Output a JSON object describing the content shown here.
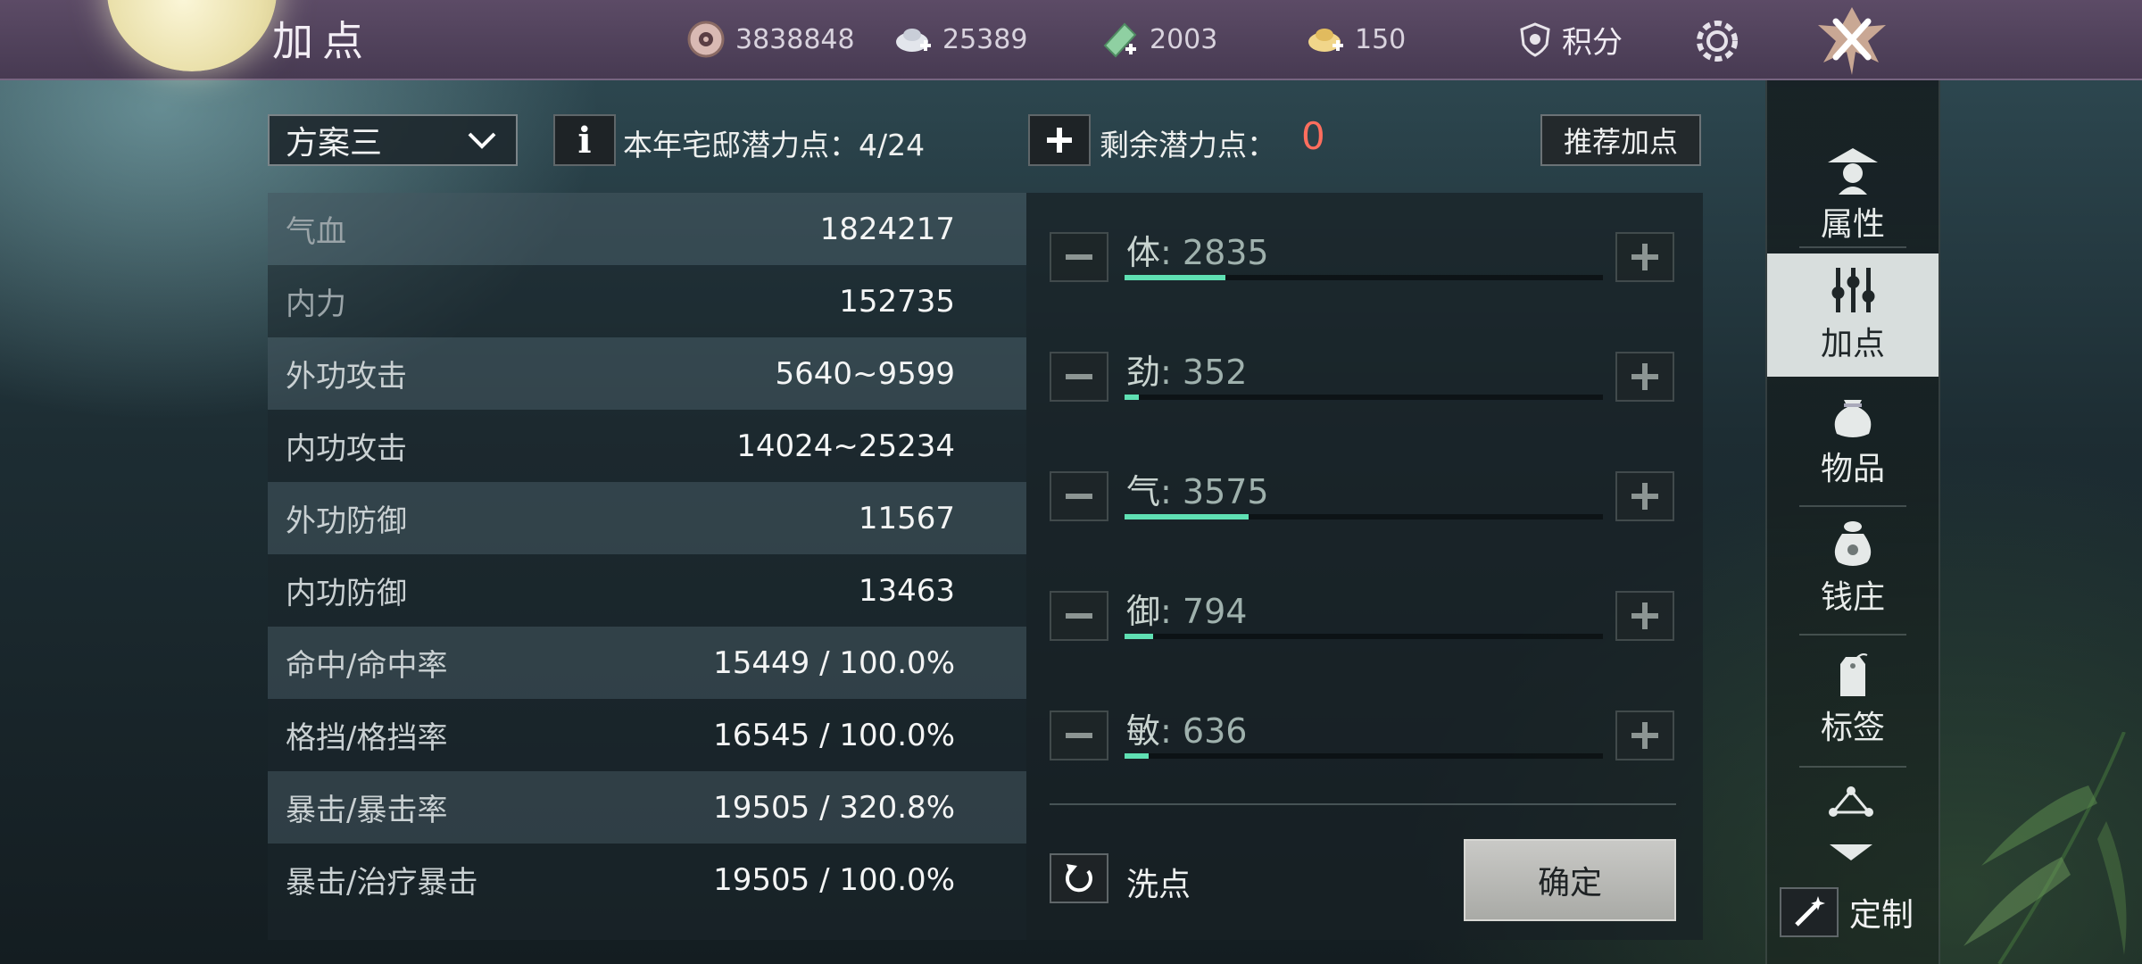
{
  "header": {
    "title": "加点",
    "currencies": [
      {
        "icon": "coin-icon",
        "value": "3838848"
      },
      {
        "icon": "silver-ingot-add-icon",
        "value": "25389"
      },
      {
        "icon": "jade-ticket-add-icon",
        "value": "2003"
      },
      {
        "icon": "gold-ingot-add-icon",
        "value": "150"
      }
    ],
    "points_label": "积分"
  },
  "controls": {
    "scheme_selected": "方案三",
    "info_glyph": "i",
    "potential_year_label": "本年宅邸潜力点：4/24",
    "remaining_label": "剩余潜力点：",
    "remaining_value": "0",
    "recommend_label": "推荐加点"
  },
  "stats": [
    {
      "label": "气血",
      "value": "1824217"
    },
    {
      "label": "内力",
      "value": "152735"
    },
    {
      "label": "外功攻击",
      "value": "5640~9599"
    },
    {
      "label": "内功攻击",
      "value": "14024~25234"
    },
    {
      "label": "外功防御",
      "value": "11567"
    },
    {
      "label": "内功防御",
      "value": "13463"
    },
    {
      "label": "命中/命中率",
      "value": "15449 / 100.0%"
    },
    {
      "label": "格挡/格挡率",
      "value": "16545 / 100.0%"
    },
    {
      "label": "暴击/暴击率",
      "value": "19505 / 320.8%"
    },
    {
      "label": "暴击/治疗暴击",
      "value": "19505 / 100.0%"
    }
  ],
  "attributes": [
    {
      "name": "体",
      "value": "2835",
      "fill": 0.21
    },
    {
      "name": "劲",
      "value": "352",
      "fill": 0.03
    },
    {
      "name": "气",
      "value": "3575",
      "fill": 0.26
    },
    {
      "name": "御",
      "value": "794",
      "fill": 0.06
    },
    {
      "name": "敏",
      "value": "636",
      "fill": 0.05
    }
  ],
  "actions": {
    "reset_label": "洗点",
    "confirm_label": "确定"
  },
  "sidebar": {
    "items": [
      {
        "label": "属性",
        "icon": "character-hat-icon",
        "active": false
      },
      {
        "label": "加点",
        "icon": "sliders-icon",
        "active": true
      },
      {
        "label": "物品",
        "icon": "bag-icon",
        "active": false
      },
      {
        "label": "钱庄",
        "icon": "money-pouch-icon",
        "active": false
      },
      {
        "label": "标签",
        "icon": "tag-icon",
        "active": false
      }
    ],
    "custom_label": "定制"
  },
  "colors": {
    "accent_bar": "#5fe0b3",
    "remaining_zero": "#ff6e5e",
    "active_tab": "#d8dedd"
  }
}
